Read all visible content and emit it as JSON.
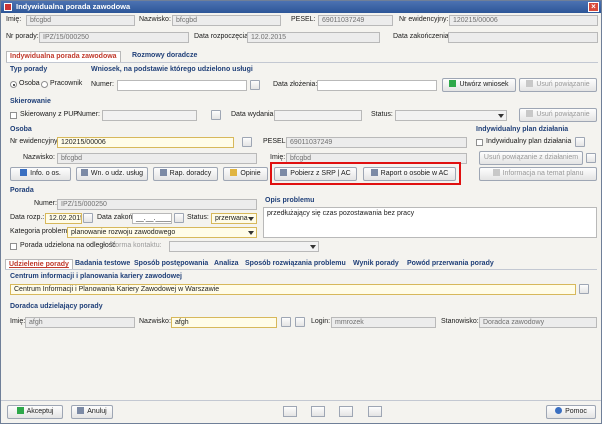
{
  "window": {
    "title": "Indywidualna porada zawodowa",
    "close": "×"
  },
  "header": {
    "imie_label": "Imię:",
    "imie": "bfcgbd",
    "nazwisko_label": "Nazwisko:",
    "nazwisko": "bfcgbd",
    "pesel_label": "PESEL:",
    "pesel": "69011037249",
    "nr_ewid_label": "Nr ewidencyjny:",
    "nr_ewid": "120215/00006",
    "nr_porady_label": "Nr porady:",
    "nr_porady": "IPZ/15/000250",
    "data_rozp_label": "Data rozpoczęcia:",
    "data_rozp": "12.02.2015",
    "data_zak_label": "Data zakończenia:",
    "data_zak": ""
  },
  "top_tabs": [
    "Indywidualna porada zawodowa",
    "Rozmowy doradcze"
  ],
  "typ_porady": {
    "title": "Typ porady",
    "opt1": "Osoba",
    "opt2": "Pracownik"
  },
  "wniosek": {
    "title": "Wniosek, na podstawie którego udzielono usługi",
    "numer_label": "Numer:",
    "data_label": "Data złożenia:",
    "utworz": "Utwórz wniosek",
    "usun": "Usuń powiązanie"
  },
  "skierowanie": {
    "title": "Skierowanie",
    "chk": "Skierowany z PUP",
    "numer_label": "Numer:",
    "data_label": "Data wydania:",
    "status_label": "Status:",
    "usun": "Usuń powiązanie"
  },
  "osoba": {
    "title": "Osoba",
    "nr_label": "Nr ewidencyjny:",
    "nr": "120215/00006",
    "pesel_label": "PESEL:",
    "pesel": "69011037249",
    "nazwisko_label": "Nazwisko:",
    "nazwisko": "bfcgbd",
    "imie_label": "Imię:",
    "imie": "bfcgbd",
    "btn_info": "Info. o os.",
    "btn_wn": "Wn. o udz. usług",
    "btn_rap": "Rap. doradcy",
    "btn_opinie": "Opinie",
    "btn_pobierz": "Pobierz z SRP | AC",
    "btn_raport": "Raport o osobie w AC"
  },
  "ipd": {
    "title": "Indywidualny plan działania",
    "chk": "Indywidualny plan działania",
    "usun": "Usuń powiązanie z działaniem",
    "info": "Informacja na temat planu"
  },
  "porada": {
    "title": "Porada",
    "numer_label": "Numer:",
    "numer": "IPZ/15/000250",
    "data_rozp_label": "Data rozp.:",
    "data_rozp": "12.02.2015",
    "data_zak_label": "Data zakoń.:",
    "data_zak": "__.__.____",
    "status_label": "Status:",
    "status": "przerwana",
    "kat_label": "Kategoria problemu:",
    "kat": "planowanie rozwoju zawodowego",
    "odl_chk": "Porada udzielona na odległość",
    "forma_label": "Forma kontaktu:"
  },
  "opis": {
    "title": "Opis problemu",
    "text": "przedłużający się czas pozostawania bez pracy"
  },
  "bottom_tabs": [
    "Udzielenie porady",
    "Badania testowe",
    "Sposób postępowania",
    "Analiza",
    "Sposób rozwiązania problemu",
    "Wynik porady",
    "Powód przerwania porady"
  ],
  "centrum": {
    "title": "Centrum informacji i planowania kariery zawodowej",
    "value": "Centrum Informacji i Planowania Kariery Zawodowej w Warszawie"
  },
  "doradca": {
    "title": "Doradca udzielający porady",
    "imie_label": "Imię:",
    "imie": "afgh",
    "nazwisko_label": "Nazwisko:",
    "nazwisko": "afgh",
    "login_label": "Login:",
    "login": "mmrozek",
    "stan_label": "Stanowisko:",
    "stan": "Doradca zawodowy"
  },
  "footer": {
    "akceptuj": "Akceptuj",
    "anuluj": "Anuluj",
    "pomoc": "Pomoc"
  },
  "colors": {
    "accent": "#1f3f78",
    "highlight": "#e01010",
    "active_tab": "#c0392b"
  }
}
